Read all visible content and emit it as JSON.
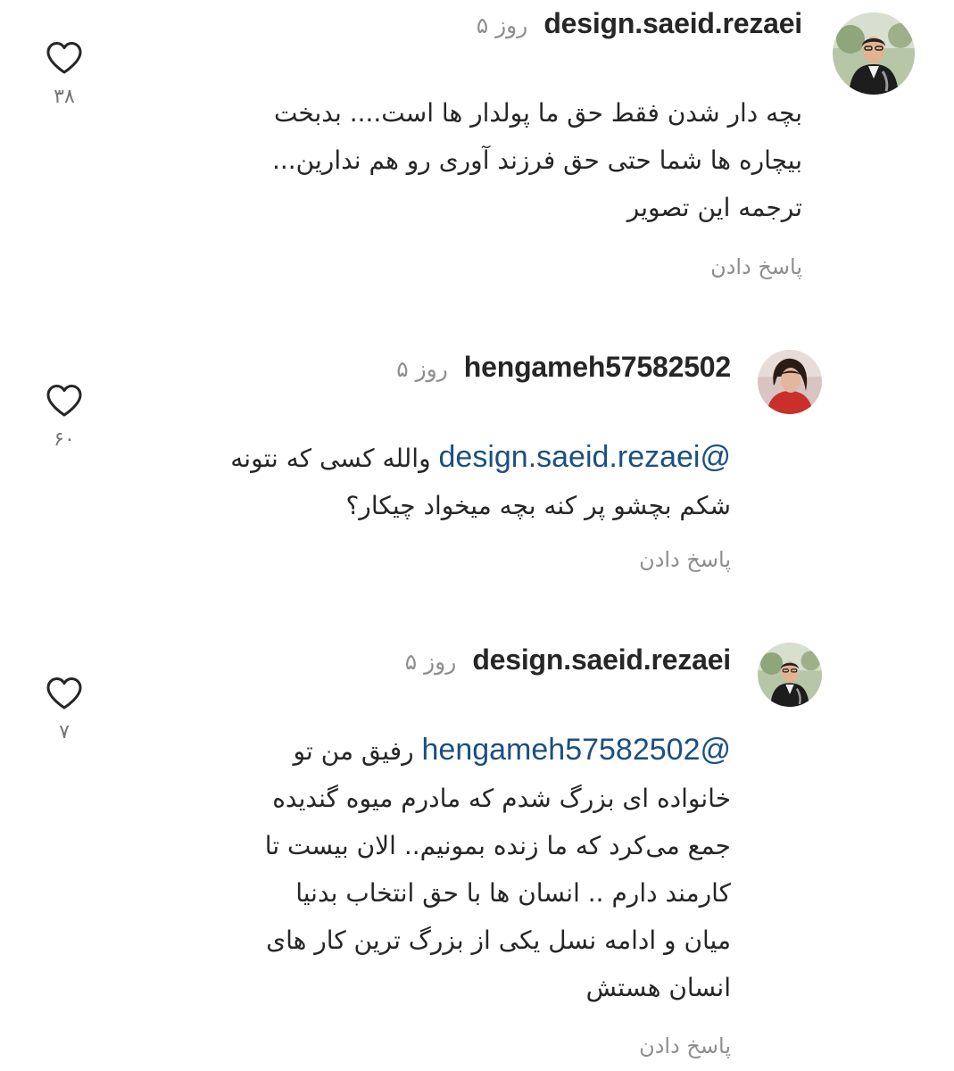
{
  "comments": [
    {
      "username": "design.saeid.rezaei",
      "time": "۵ روز",
      "mention": "",
      "lines": [
        "بچه دار شدن فقط حق ما پولدار ها است.... بدبخت",
        "بیچاره ها شما حتی حق فرزند آوری رو هم ندارین...",
        "ترجمه این تصویر"
      ],
      "reply_label": "پاسخ دادن",
      "likes": "۳۸",
      "avatar_icon": "man-portrait-icon"
    },
    {
      "username": "hengameh57582502",
      "time": "۵ روز",
      "mention": "@design.saeid.rezaei",
      "lines": [
        " والله کسی که نتونه",
        "شکم بچشو پر کنه بچه میخواد چیکار؟"
      ],
      "reply_label": "پاسخ دادن",
      "likes": "۶۰",
      "avatar_icon": "woman-portrait-icon"
    },
    {
      "username": "design.saeid.rezaei",
      "time": "۵ روز",
      "mention": "@hengameh57582502",
      "lines": [
        " رفیق من تو",
        "خانواده ای بزرگ شدم که مادرم میوه گندیده",
        "جمع می‌کرد که ما زنده بمونیم.. الان  بیست تا",
        "کارمند دارم .. انسان ها با حق انتخاب بدنیا",
        "میان و ادامه نسل یکی از بزرگ ترین کار های",
        "انسان هستش"
      ],
      "reply_label": "پاسخ دادن",
      "likes": "۷",
      "avatar_icon": "man-portrait-icon"
    }
  ],
  "colors": {
    "text": "#262626",
    "secondary": "#8e8e8e",
    "mention": "#1c4f82",
    "background": "#ffffff"
  }
}
